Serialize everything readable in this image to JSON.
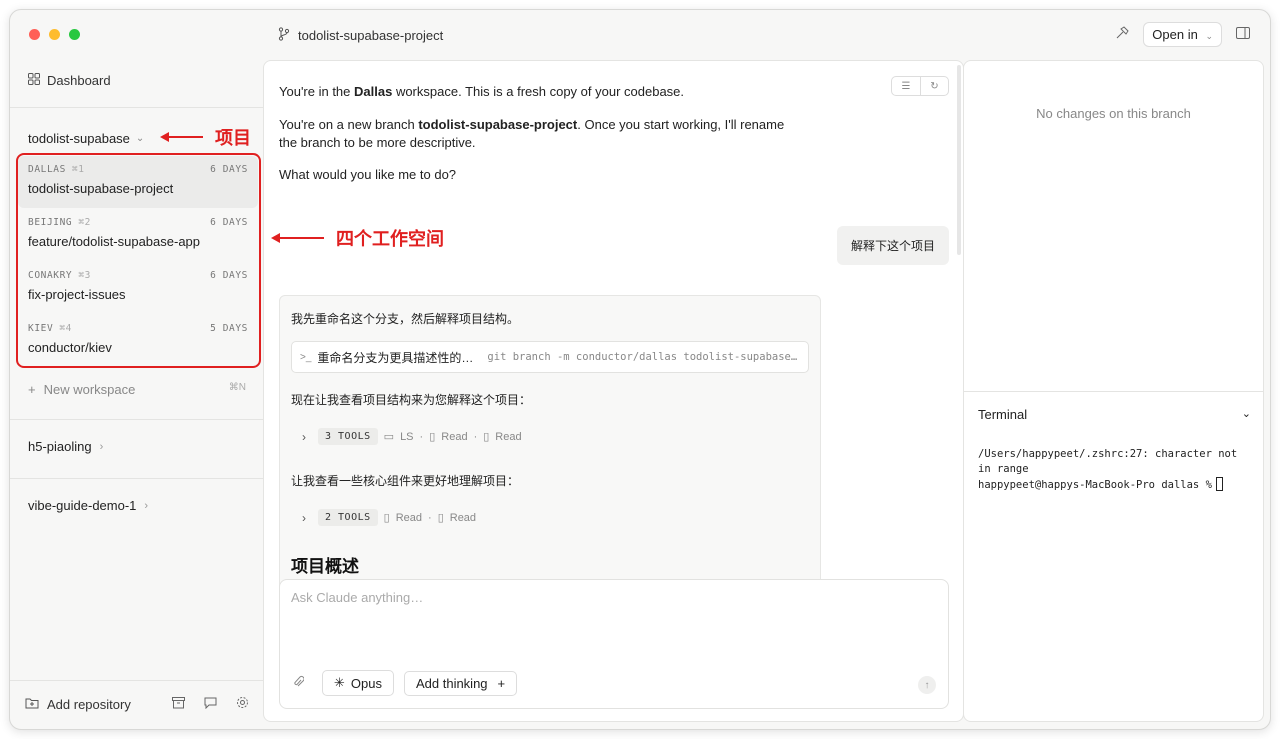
{
  "window": {
    "title": "todolist-supabase-project"
  },
  "sidebar": {
    "dashboard_label": "Dashboard",
    "project_name": "todolist-supabase",
    "workspaces": [
      {
        "city": "DALLAS",
        "key": "⌘1",
        "age": "6 DAYS",
        "branch": "todolist-supabase-project",
        "active": true
      },
      {
        "city": "BEIJING",
        "key": "⌘2",
        "age": "6 DAYS",
        "branch": "feature/todolist-supabase-app",
        "active": false
      },
      {
        "city": "CONAKRY",
        "key": "⌘3",
        "age": "6 DAYS",
        "branch": "fix-project-issues",
        "active": false
      },
      {
        "city": "KIEV",
        "key": "⌘4",
        "age": "5 DAYS",
        "branch": "conductor/kiev",
        "active": false
      }
    ],
    "new_workspace": {
      "label": "New workspace",
      "shortcut": "⌘N"
    },
    "repos": [
      "h5-piaoling",
      "vibe-guide-demo-1"
    ],
    "add_repository": "Add repository"
  },
  "toolbar": {
    "open_in": "Open in"
  },
  "chat": {
    "intro_1_pre": "You're in the ",
    "intro_1_bold": "Dallas",
    "intro_1_post": " workspace. This is a fresh copy of your codebase.",
    "intro_2_pre": "You're on a new branch ",
    "intro_2_bold": "todolist-supabase-project",
    "intro_2_post": ". Once you start working, I'll rename",
    "intro_2_line2": "the branch to be more descriptive.",
    "intro_3": "What would you like me to do?",
    "user_message": "解释下这个项目",
    "assistant": {
      "line1": "我先重命名这个分支，然后解释项目结构。",
      "cmd_desc": "重命名分支为更具描述性的…",
      "cmd_code": "git branch -m conductor/dallas todolist-supabase…",
      "line2": "现在让我查看项目结构来为您解释这个项目：",
      "tools1": {
        "badge": "3 TOOLS",
        "items": [
          "LS",
          "Read",
          "Read"
        ]
      },
      "line3": "让我查看一些核心组件来更好地理解项目：",
      "tools2": {
        "badge": "2 TOOLS",
        "items": [
          "Read",
          "Read"
        ]
      },
      "heading": "项目概述"
    },
    "input_placeholder": "Ask Claude anything…",
    "model": "Opus",
    "thinking": "Add thinking"
  },
  "right_panel": {
    "no_changes": "No changes on this branch",
    "terminal_title": "Terminal",
    "terminal_lines": "/Users/happypeet/.zshrc:27: character not in range\nhappypeet@happys-MacBook-Pro dallas %"
  },
  "annotations": {
    "project": "项目",
    "workspaces": "四个工作空间"
  },
  "colors": {
    "annotation": "#e02020",
    "active_item": "#ebebea"
  }
}
